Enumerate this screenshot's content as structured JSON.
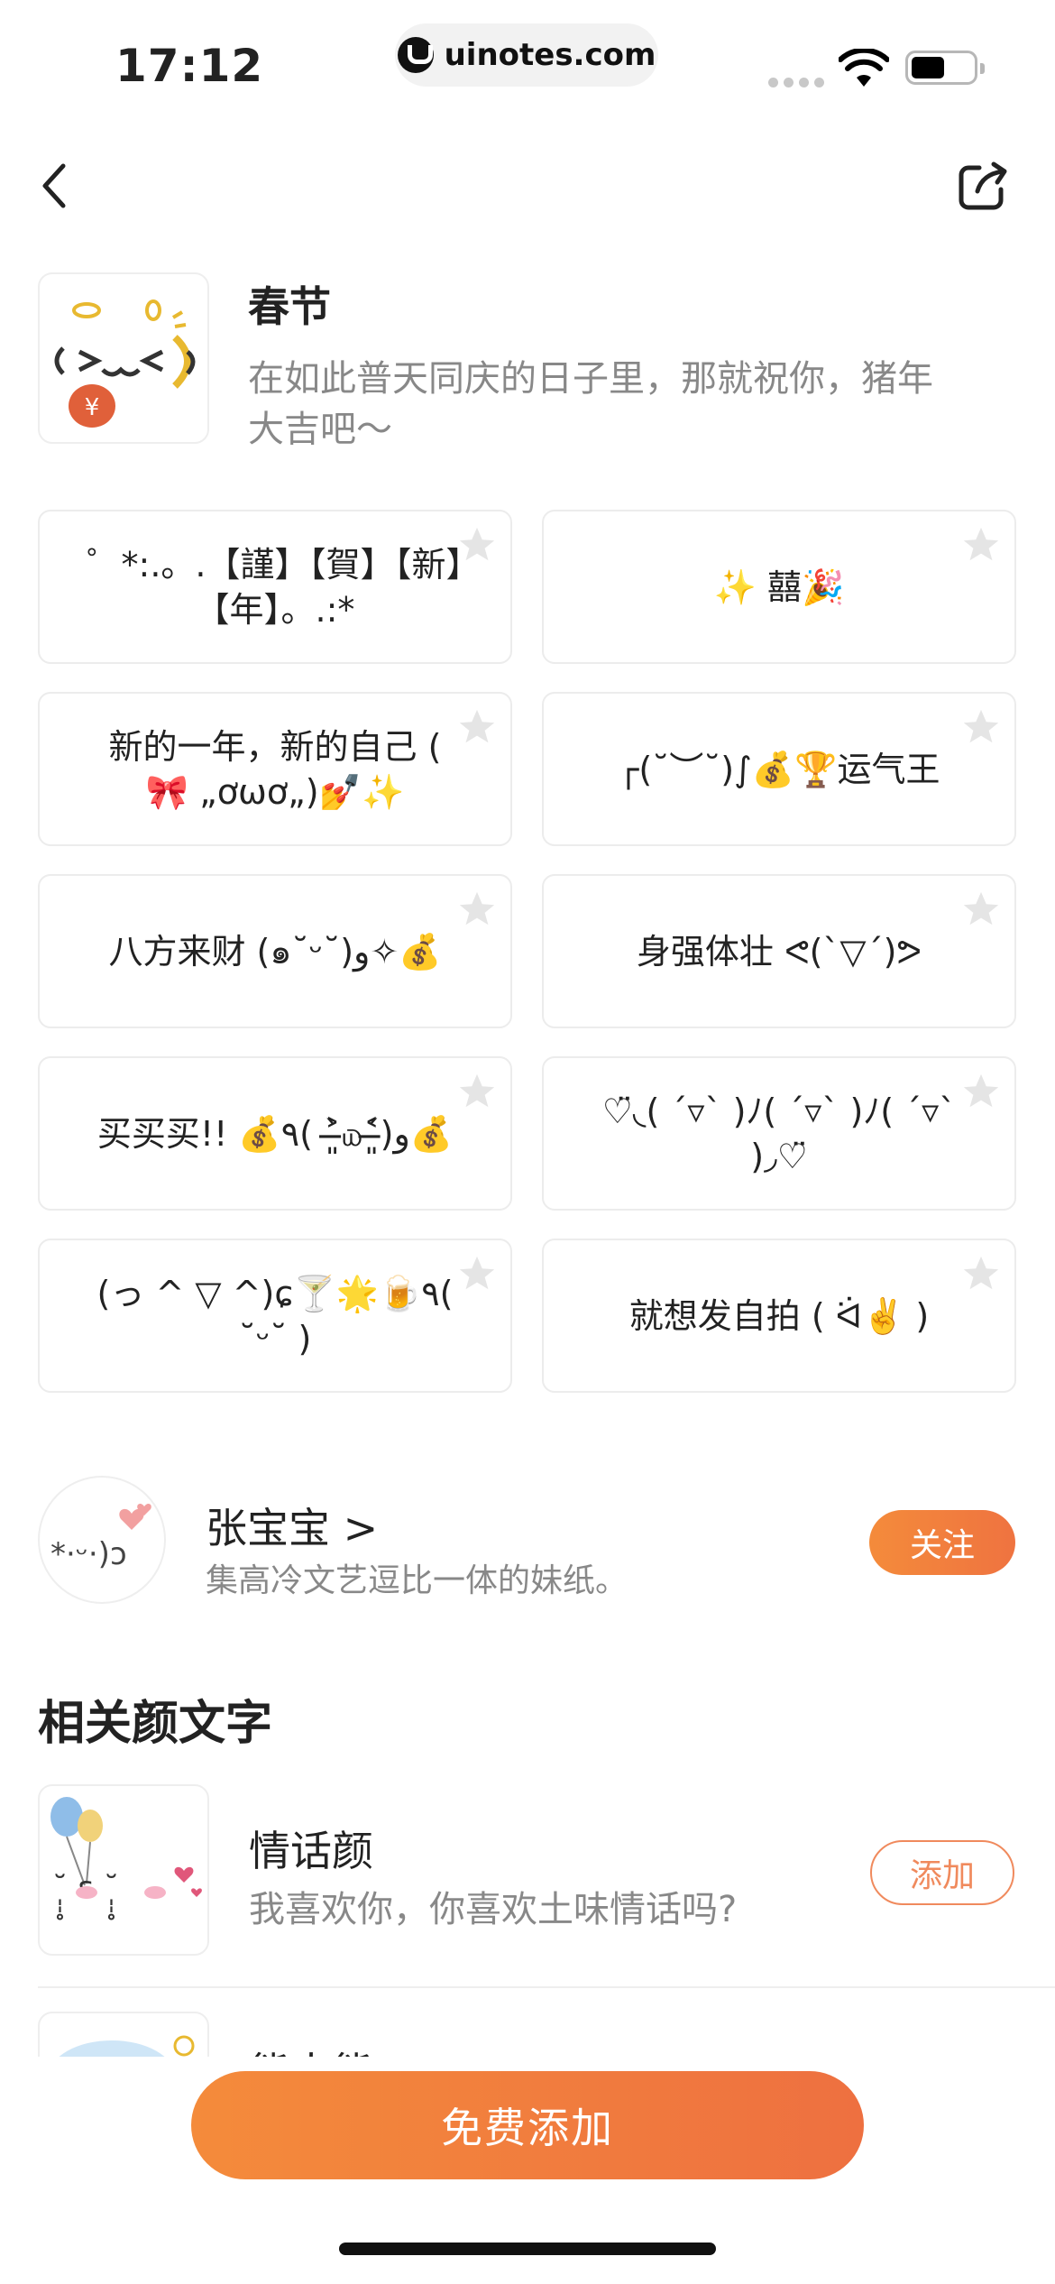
{
  "status_bar": {
    "time": "17:12",
    "url": "uinotes.com",
    "battery_level": 0.54
  },
  "nav": {
    "back_icon": "chevron-left-icon",
    "share_icon": "share-icon"
  },
  "pack": {
    "title": "春节",
    "description": "在如此普天同庆的日子里，那就祝你，猪年大吉吧～"
  },
  "emoticons": [
    {
      "text": "゜*:.。.【謹】【賀】【新】【年】。.:*"
    },
    {
      "text": "✨ 囍🎉"
    },
    {
      "text": "新的一年，新的自己 ( 🎀 „ơωơ„)💅✨"
    },
    {
      "text": "┌(˘︶˘)∫💰🏆运气王"
    },
    {
      "text": "八方来财 (๑˘ᵕ˘)و✧💰"
    },
    {
      "text": "身强体壮 ᕙ(`▽´)ᕗ"
    },
    {
      "text": "买买买!! 💰٩( ˃̶͈̀௰˂̶͈́)و💰"
    },
    {
      "text": "♡̈◟( ´▿` )ﾉ( ´▿` )ﾉ( ´▿` )◞♡̈"
    },
    {
      "text": "(っ ^ ▽ ^)ɕ🍸🌟🍺٩( ˘ᵕ˘ )"
    },
    {
      "text": "就想发自拍 ( ᐛ✌️ )"
    }
  ],
  "author": {
    "name": "张宝宝",
    "name_chevron": ">",
    "bio": "集高冷文艺逗比一体的妹纸。",
    "follow_label": "关注"
  },
  "related": {
    "heading": "相关颜文字",
    "items": [
      {
        "title": "情话颜",
        "description": "我喜欢你，你喜欢土味情话吗?",
        "button": "添加"
      },
      {
        "title": "熊大熊"
      }
    ]
  },
  "cta": {
    "label": "免费添加"
  },
  "colors": {
    "accent": "#F07A3E",
    "text_primary": "#222222",
    "text_secondary": "#888888",
    "card_border": "#ECECEC"
  }
}
